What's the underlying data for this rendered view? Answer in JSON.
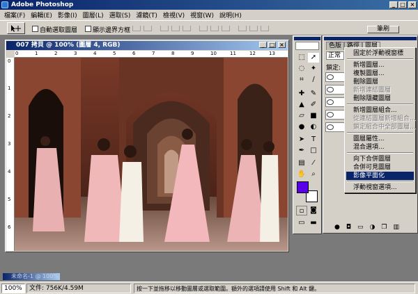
{
  "app": {
    "title": "Adobe Photoshop"
  },
  "menu": [
    "檔案(F)",
    "編輯(E)",
    "影像(I)",
    "圖層(L)",
    "選取(S)",
    "濾鏡(T)",
    "檢視(V)",
    "視窗(W)",
    "說明(H)"
  ],
  "options": {
    "auto_select_label": "自動選取圖層",
    "show_bounds_label": "顯示邊界方框"
  },
  "document": {
    "title": "007 拷貝 @ 100% (圖層 4, RGB)",
    "ruler_h": [
      "0",
      "1",
      "2",
      "3",
      "4",
      "5",
      "6",
      "7",
      "8",
      "9",
      "10",
      "11",
      "12",
      "13"
    ],
    "ruler_v": [
      "0",
      "1",
      "2",
      "3",
      "4",
      "5",
      "6"
    ]
  },
  "top_tab": "筆刷",
  "palette": {
    "tabs": [
      "色版",
      "路徑",
      "圖層"
    ],
    "blend_mode": "正常",
    "lock_label": "鎖定:"
  },
  "context_menu": {
    "items": [
      {
        "label": "固定於浮動視窗標",
        "disabled": false,
        "selected": false
      },
      {
        "sep": true
      },
      {
        "label": "新增圖層...",
        "disabled": false,
        "selected": false
      },
      {
        "label": "複製圖層...",
        "disabled": false,
        "selected": false
      },
      {
        "label": "刪除圖層",
        "disabled": false,
        "selected": false
      },
      {
        "label": "新增連結圖層",
        "disabled": true,
        "selected": false
      },
      {
        "label": "刪除隱藏圖層",
        "disabled": false,
        "selected": false
      },
      {
        "sep": true
      },
      {
        "label": "新增圖層組合...",
        "disabled": false,
        "selected": false
      },
      {
        "label": "從連結圖層新增組合...",
        "disabled": true,
        "selected": false
      },
      {
        "label": "鎖定組合中全部圖層...",
        "disabled": true,
        "selected": false
      },
      {
        "sep": true
      },
      {
        "label": "圖層屬性...",
        "disabled": false,
        "selected": false
      },
      {
        "label": "混合選項...",
        "disabled": false,
        "selected": false
      },
      {
        "sep": true
      },
      {
        "label": "向下合併圖層",
        "disabled": false,
        "selected": false
      },
      {
        "label": "合併可見圖層",
        "disabled": false,
        "selected": false
      },
      {
        "label": "影像平面化",
        "disabled": false,
        "selected": true
      },
      {
        "sep": true
      },
      {
        "label": "浮動視窗選項...",
        "disabled": false,
        "selected": false
      }
    ]
  },
  "minimized_window": "未命名-1 @ 100%",
  "status": {
    "zoom": "100%",
    "doc_size": "文件: 756K/4.59M",
    "hint": "按一下並拖移以移動圖層或選取範圍。額外的選項請使用 Shift 和 Alt 鍵。"
  },
  "colors": {
    "foreground": "#5a00e8",
    "background": "#ffffff",
    "title_active": "#0a246a",
    "menu_highlight": "#0a246a"
  }
}
